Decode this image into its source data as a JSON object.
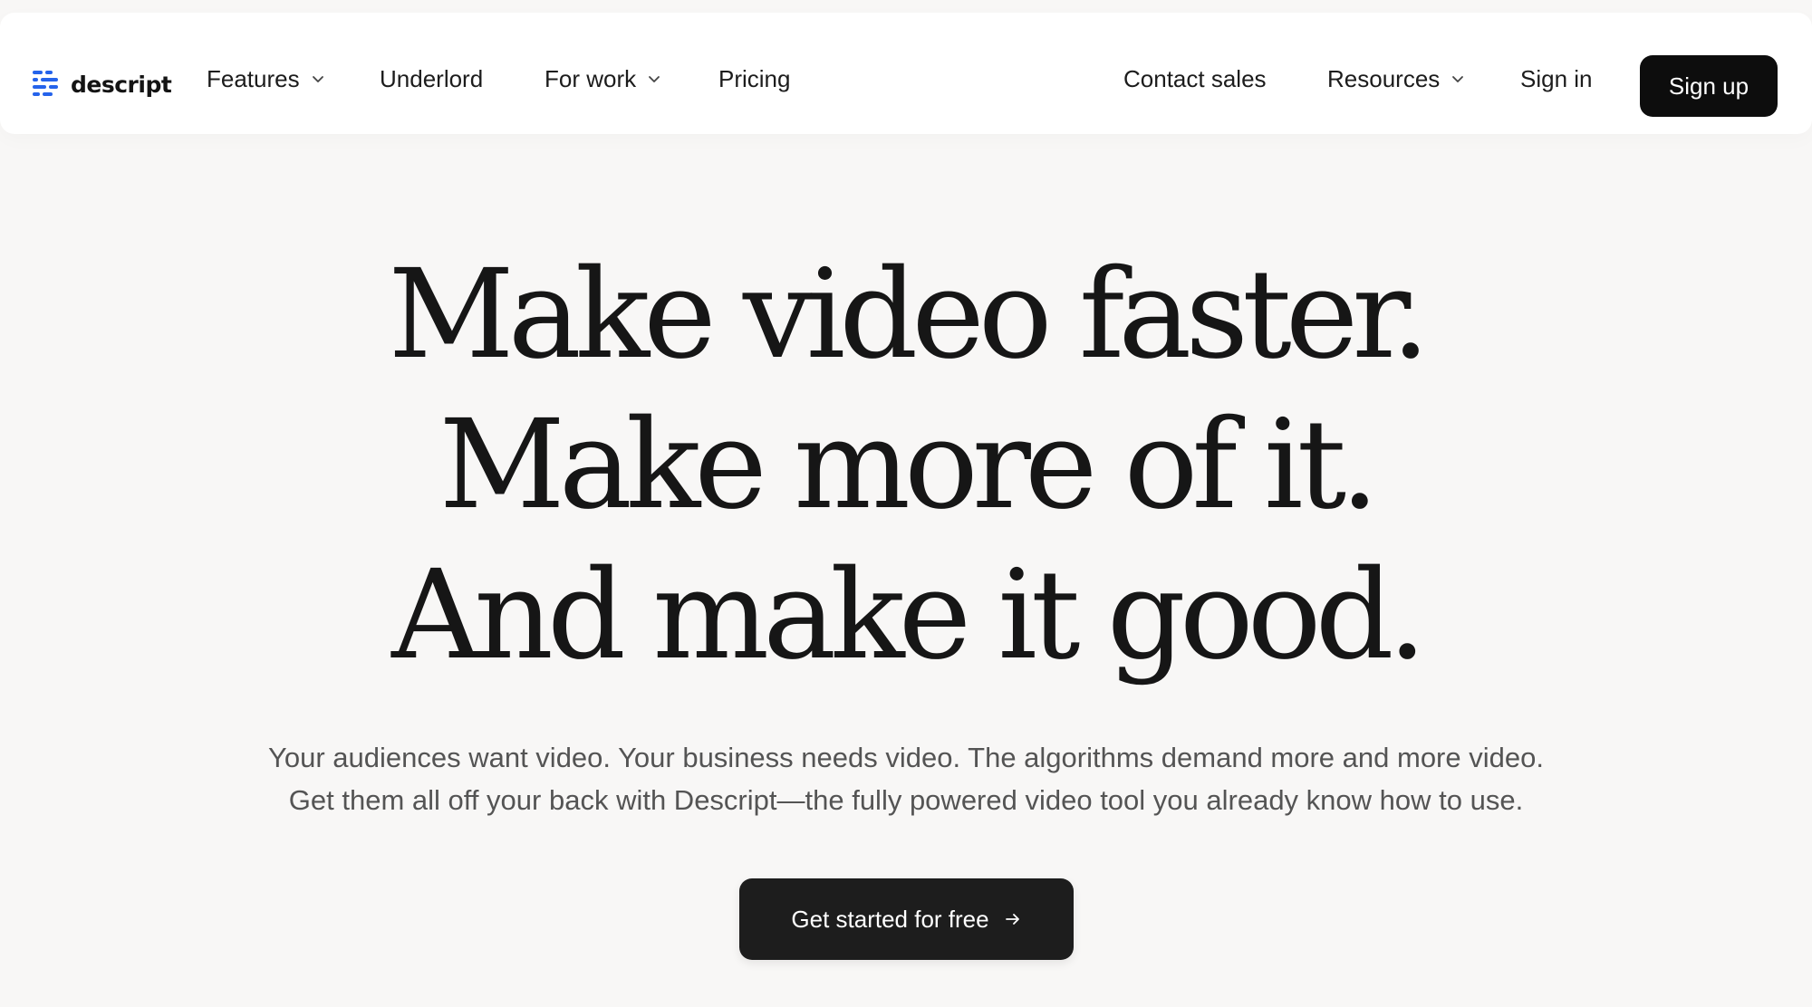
{
  "brand": {
    "name": "descript",
    "logo_icon": "descript-logo-icon",
    "logo_color": "#2563eb"
  },
  "nav": {
    "items": [
      {
        "label": "Features",
        "has_dropdown": true
      },
      {
        "label": "Underlord",
        "has_dropdown": false
      },
      {
        "label": "For work",
        "has_dropdown": true
      },
      {
        "label": "Pricing",
        "has_dropdown": false
      }
    ],
    "right_items": [
      {
        "label": "Contact sales",
        "has_dropdown": false
      },
      {
        "label": "Resources",
        "has_dropdown": true
      },
      {
        "label": "Sign in",
        "has_dropdown": false
      }
    ],
    "signup_label": "Sign up",
    "dropdown_icon": "chevron-down-icon"
  },
  "hero": {
    "headline": [
      "Make video faster.",
      "Make more of it.",
      "And make it good."
    ],
    "subtitle": [
      "Your audiences want video. Your business needs video. The algorithms demand more and more video.",
      "Get them all off your back with Descript—the fully powered video tool you already know how to use."
    ],
    "cta_label": "Get started for free",
    "cta_icon": "arrow-right-icon"
  },
  "colors": {
    "page_background": "#f8f7f6",
    "nav_background": "#ffffff",
    "primary_button": "#0d0d0d",
    "text": "#161616",
    "muted_text": "#545454"
  }
}
